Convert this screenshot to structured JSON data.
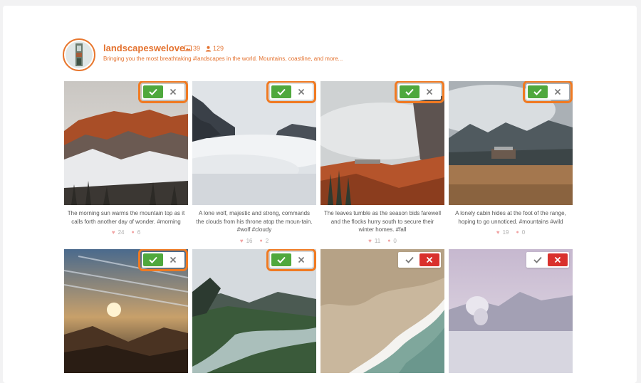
{
  "profile": {
    "username": "landscapeswelove",
    "posts_count": "39",
    "followers_count": "129",
    "bio": "Bringing you the most breathtaking #landscapes in the world. Mountains, coastline, and more..."
  },
  "posts": [
    {
      "caption": "The morning sun warms the mountain top as it calls forth another day of wonder. #morning",
      "likes": "24",
      "comments": "6",
      "status": "approved",
      "highlighted": true
    },
    {
      "caption": "A lone wolf, majestic and strong, commands the clouds from his throne atop the moun-tain. #wolf #cloudy",
      "likes": "16",
      "comments": "2",
      "status": "approved",
      "highlighted": true
    },
    {
      "caption": "The leaves tumble as the season bids farewell and the flocks hurry south to secure their winter homes. #fall",
      "likes": "11",
      "comments": "0",
      "status": "approved",
      "highlighted": true
    },
    {
      "caption": "A lonely cabin hides at the foot of the range, hoping to go unnoticed. #mountains #wild",
      "likes": "19",
      "comments": "0",
      "status": "approved",
      "highlighted": true
    },
    {
      "caption": "",
      "likes": "",
      "comments": "",
      "status": "approved",
      "highlighted": true
    },
    {
      "caption": "",
      "likes": "",
      "comments": "",
      "status": "approved",
      "highlighted": true
    },
    {
      "caption": "",
      "likes": "",
      "comments": "",
      "status": "rejected",
      "highlighted": false
    },
    {
      "caption": "",
      "likes": "",
      "comments": "",
      "status": "rejected",
      "highlighted": false
    }
  ],
  "colors": {
    "accent": "#e4722f",
    "approve": "#4fa83d",
    "reject": "#d9302c",
    "highlight": "#f07a22"
  },
  "icons": [
    "image-icon",
    "user-icon",
    "check-icon",
    "close-icon",
    "heart-icon",
    "comment-icon"
  ]
}
